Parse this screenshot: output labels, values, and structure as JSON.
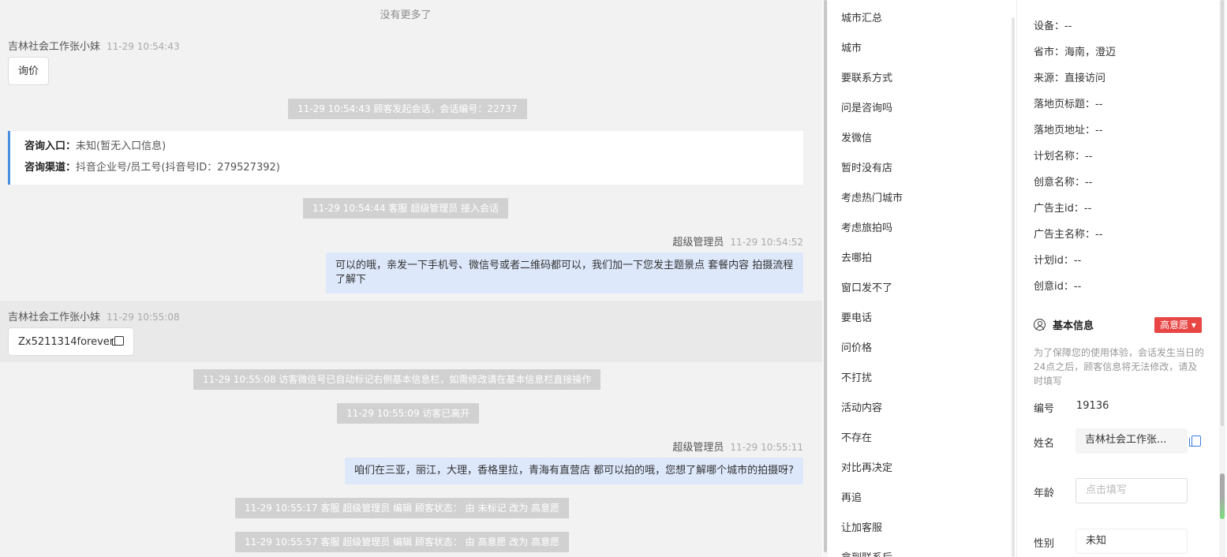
{
  "chat": {
    "no_more": "没有更多了",
    "msg1_sender": "吉林社会工作张小妹",
    "msg1_time": "11-29 10:54:43",
    "msg1_text": "询价",
    "sys1": "11-29 10:54:43 顾客发起会话，会话编号：22737",
    "entry_label1": "咨询入口：",
    "entry_value1": "未知(暂无入口信息)",
    "entry_label2": "咨询渠道：",
    "entry_value2": "抖音企业号/员工号(抖音号ID：279527392)",
    "sys2": "11-29 10:54:44 客服 超级管理员 接入会话",
    "agent1_name": "超级管理员",
    "agent1_time": "11-29 10:54:52",
    "agent1_text": "可以的哦，亲发一下手机号、微信号或者二维码都可以，我们加一下您发主题景点 套餐内容 拍摄流程了解下",
    "msg2_sender": "吉林社会工作张小妹",
    "msg2_time": "11-29 10:55:08",
    "msg2_text": "Zx5211314forever",
    "sys3": "11-29 10:55:08 访客微信号已自动标记右侧基本信息栏，如需修改请在基本信息栏直接操作",
    "sys4": "11-29 10:55:09 访客已离开",
    "agent2_name": "超级管理员",
    "agent2_time": "11-29 10:55:11",
    "agent2_text": "咱们在三亚，丽江，大理，香格里拉，青海有直营店 都可以拍的哦，您想了解哪个城市的拍摄呀?",
    "sys5": "11-29 10:55:17 客服 超级管理员 编辑 顾客状态： 由 未标记 改为 高意愿",
    "sys6": "11-29 10:55:57 客服 超级管理员 编辑 顾客状态： 由 高意愿 改为 高意愿"
  },
  "quick_replies": [
    "城市汇总",
    "城市",
    "要联系方式",
    "问是咨询吗",
    "发微信",
    "暂时没有店",
    "考虑热门城市",
    "考虑旅拍吗",
    "去哪拍",
    "窗口发不了",
    "要电话",
    "问价格",
    "不打扰",
    "活动内容",
    "不存在",
    "对比再决定",
    "再追",
    "让加客服",
    "拿到联系后"
  ],
  "info": {
    "fields": [
      {
        "label": "设备：",
        "value": "--"
      },
      {
        "label": "省市：",
        "value": "海南，澄迈"
      },
      {
        "label": "来源：",
        "value": "直接访问"
      },
      {
        "label": "落地页标题：",
        "value": "--"
      },
      {
        "label": "落地页地址：",
        "value": "--"
      },
      {
        "label": "计划名称：",
        "value": "--"
      },
      {
        "label": "创意名称：",
        "value": "--"
      },
      {
        "label": "广告主id：",
        "value": "--"
      },
      {
        "label": "广告主名称：",
        "value": "--"
      },
      {
        "label": "计划id：",
        "value": "--"
      },
      {
        "label": "创意id：",
        "value": "--"
      }
    ],
    "section_title": "基本信息",
    "intent_badge": "高意愿 ▾",
    "note": "为了保障您的使用体验，会话发生当日的24点之后，顾客信息将无法修改，请及时填写",
    "id_label": "编号",
    "id_value": "19136",
    "name_label": "姓名",
    "name_value": "吉林社会工作张...",
    "age_label": "年龄",
    "age_placeholder": "点击填写",
    "gender_label": "性别",
    "gender_value": "未知"
  },
  "colors": {
    "accent": "#4a90e2",
    "badge": "#e84545",
    "agent_bubble": "#dde8fb",
    "system": "#d1d1d1"
  }
}
